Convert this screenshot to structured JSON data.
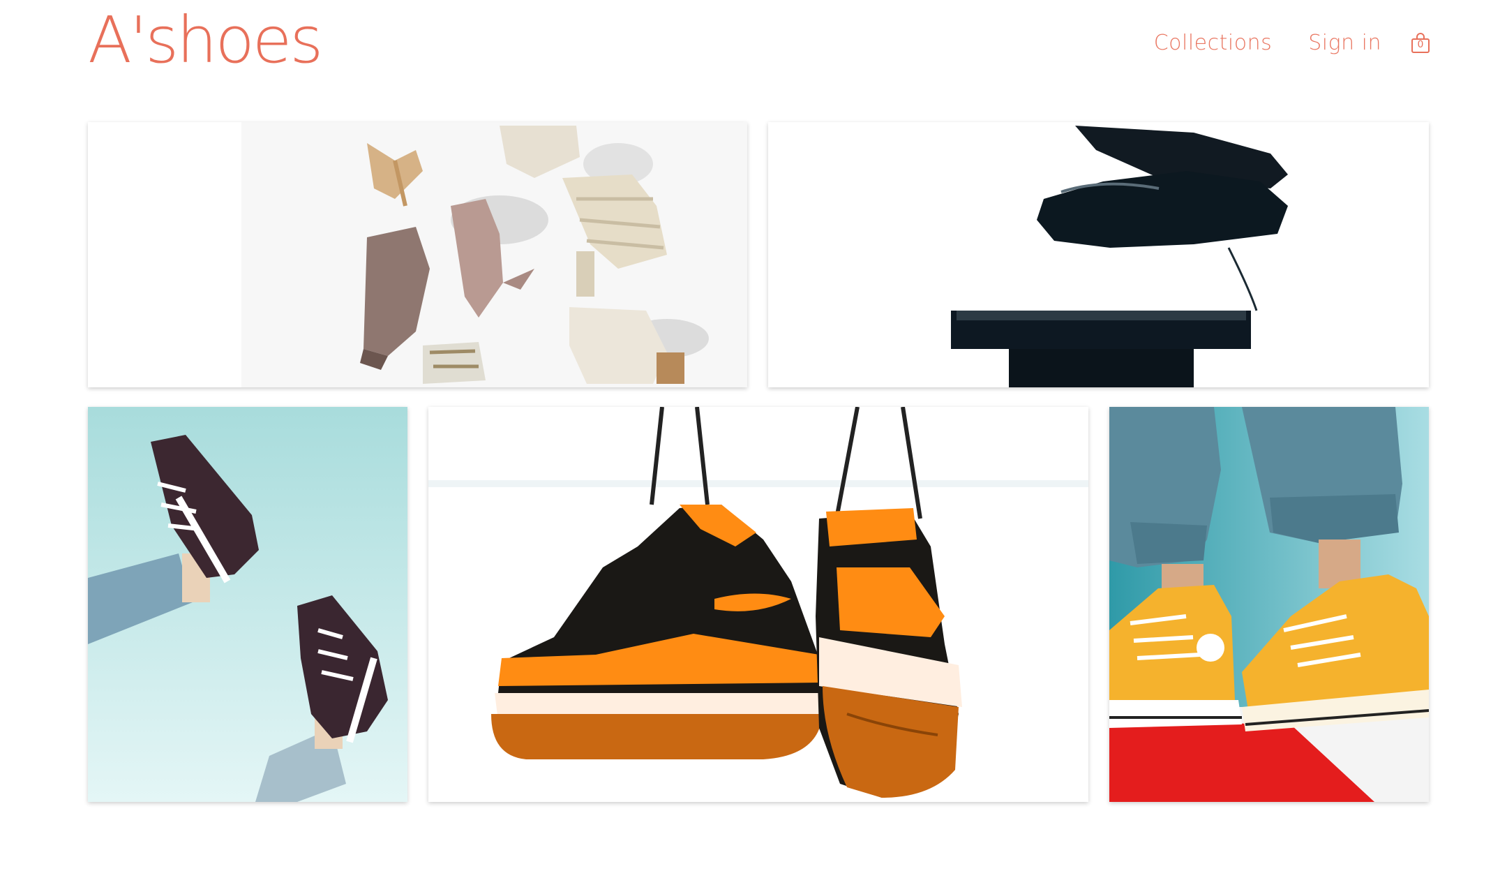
{
  "brand": {
    "logo_text": "A'shoes",
    "color": "#e8705a"
  },
  "nav": {
    "links": [
      "Collections",
      "Sign in"
    ],
    "cart_icon": "shopping-bag-icon",
    "cart_count": "0"
  },
  "tiles": [
    {
      "subject": "heels-flatlay-image"
    },
    {
      "subject": "leather-dress-shoes-image"
    },
    {
      "subject": "checkered-sneakers-image"
    },
    {
      "subject": "hanging-orange-sneakers-image"
    },
    {
      "subject": "yellow-hightop-sneakers-image"
    }
  ],
  "colors": {
    "accent": "#e8705a",
    "background": "#ffffff",
    "sky": "#bfe6e6",
    "orange": "#ff8a14",
    "yellow": "#f6b52a",
    "red": "#e51f1f"
  }
}
